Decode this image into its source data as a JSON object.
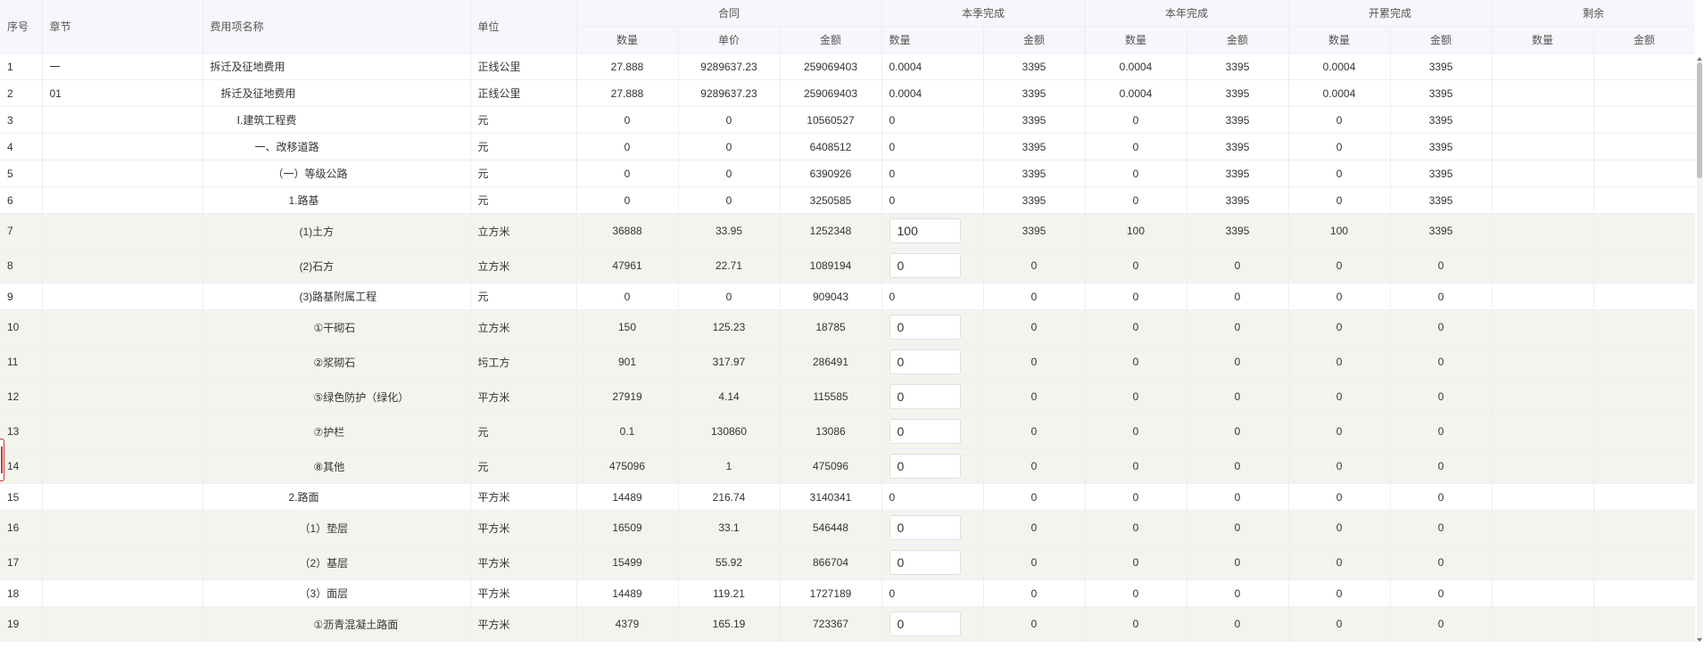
{
  "headers": {
    "seq": "序号",
    "chapter": "章节",
    "name": "费用项名称",
    "unit": "单位",
    "groups": [
      "合同",
      "本季完成",
      "本年完成",
      "开累完成",
      "剩余"
    ],
    "contract_sub": [
      "数量",
      "单价",
      "金额"
    ],
    "pair_sub": [
      "数量",
      "金额"
    ]
  },
  "rows": [
    {
      "seq": "1",
      "chapter": "一",
      "name": "拆迁及征地费用",
      "indent": 0,
      "unit": "正线公里",
      "c_qty": "27.888",
      "c_price": "9289637.23",
      "c_amt": "259069403",
      "q_qty": "0.0004",
      "q_amt": "3395",
      "y_qty": "0.0004",
      "y_amt": "3395",
      "t_qty": "0.0004",
      "t_amt": "3395",
      "r_qty": "",
      "r_amt": "",
      "editable": false
    },
    {
      "seq": "2",
      "chapter": "01",
      "name": "拆迁及征地费用",
      "indent": 1,
      "unit": "正线公里",
      "c_qty": "27.888",
      "c_price": "9289637.23",
      "c_amt": "259069403",
      "q_qty": "0.0004",
      "q_amt": "3395",
      "y_qty": "0.0004",
      "y_amt": "3395",
      "t_qty": "0.0004",
      "t_amt": "3395",
      "r_qty": "",
      "r_amt": "",
      "editable": false
    },
    {
      "seq": "3",
      "chapter": "",
      "name": "Ⅰ.建筑工程费",
      "indent": 2,
      "unit": "元",
      "c_qty": "0",
      "c_price": "0",
      "c_amt": "10560527",
      "q_qty": "0",
      "q_amt": "3395",
      "y_qty": "0",
      "y_amt": "3395",
      "t_qty": "0",
      "t_amt": "3395",
      "r_qty": "",
      "r_amt": "",
      "editable": false
    },
    {
      "seq": "4",
      "chapter": "",
      "name": "一、改移道路",
      "indent": 3,
      "unit": "元",
      "c_qty": "0",
      "c_price": "0",
      "c_amt": "6408512",
      "q_qty": "0",
      "q_amt": "3395",
      "y_qty": "0",
      "y_amt": "3395",
      "t_qty": "0",
      "t_amt": "3395",
      "r_qty": "",
      "r_amt": "",
      "editable": false
    },
    {
      "seq": "5",
      "chapter": "",
      "name": "（一）等级公路",
      "indent": 4,
      "unit": "元",
      "c_qty": "0",
      "c_price": "0",
      "c_amt": "6390926",
      "q_qty": "0",
      "q_amt": "3395",
      "y_qty": "0",
      "y_amt": "3395",
      "t_qty": "0",
      "t_amt": "3395",
      "r_qty": "",
      "r_amt": "",
      "editable": false
    },
    {
      "seq": "6",
      "chapter": "",
      "name": "1.路基",
      "indent": 5,
      "unit": "元",
      "c_qty": "0",
      "c_price": "0",
      "c_amt": "3250585",
      "q_qty": "0",
      "q_amt": "3395",
      "y_qty": "0",
      "y_amt": "3395",
      "t_qty": "0",
      "t_amt": "3395",
      "r_qty": "",
      "r_amt": "",
      "editable": false
    },
    {
      "seq": "7",
      "chapter": "",
      "name": "(1)土方",
      "indent": 6,
      "unit": "立方米",
      "c_qty": "36888",
      "c_price": "33.95",
      "c_amt": "1252348",
      "q_qty": "100",
      "q_amt": "3395",
      "y_qty": "100",
      "y_amt": "3395",
      "t_qty": "100",
      "t_amt": "3395",
      "r_qty": "",
      "r_amt": "",
      "editable": true
    },
    {
      "seq": "8",
      "chapter": "",
      "name": "(2)石方",
      "indent": 6,
      "unit": "立方米",
      "c_qty": "47961",
      "c_price": "22.71",
      "c_amt": "1089194",
      "q_qty": "0",
      "q_amt": "0",
      "y_qty": "0",
      "y_amt": "0",
      "t_qty": "0",
      "t_amt": "0",
      "r_qty": "",
      "r_amt": "",
      "editable": true
    },
    {
      "seq": "9",
      "chapter": "",
      "name": "(3)路基附属工程",
      "indent": 6,
      "unit": "元",
      "c_qty": "0",
      "c_price": "0",
      "c_amt": "909043",
      "q_qty": "0",
      "q_amt": "0",
      "y_qty": "0",
      "y_amt": "0",
      "t_qty": "0",
      "t_amt": "0",
      "r_qty": "",
      "r_amt": "",
      "editable": false
    },
    {
      "seq": "10",
      "chapter": "",
      "name": "①干砌石",
      "indent": 7,
      "unit": "立方米",
      "c_qty": "150",
      "c_price": "125.23",
      "c_amt": "18785",
      "q_qty": "0",
      "q_amt": "0",
      "y_qty": "0",
      "y_amt": "0",
      "t_qty": "0",
      "t_amt": "0",
      "r_qty": "",
      "r_amt": "",
      "editable": true
    },
    {
      "seq": "11",
      "chapter": "",
      "name": "②浆砌石",
      "indent": 7,
      "unit": "圬工方",
      "c_qty": "901",
      "c_price": "317.97",
      "c_amt": "286491",
      "q_qty": "0",
      "q_amt": "0",
      "y_qty": "0",
      "y_amt": "0",
      "t_qty": "0",
      "t_amt": "0",
      "r_qty": "",
      "r_amt": "",
      "editable": true
    },
    {
      "seq": "12",
      "chapter": "",
      "name": "⑤绿色防护（绿化）",
      "indent": 7,
      "unit": "平方米",
      "c_qty": "27919",
      "c_price": "4.14",
      "c_amt": "115585",
      "q_qty": "0",
      "q_amt": "0",
      "y_qty": "0",
      "y_amt": "0",
      "t_qty": "0",
      "t_amt": "0",
      "r_qty": "",
      "r_amt": "",
      "editable": true
    },
    {
      "seq": "13",
      "chapter": "",
      "name": "⑦护栏",
      "indent": 7,
      "unit": "元",
      "c_qty": "0.1",
      "c_price": "130860",
      "c_amt": "13086",
      "q_qty": "0",
      "q_amt": "0",
      "y_qty": "0",
      "y_amt": "0",
      "t_qty": "0",
      "t_amt": "0",
      "r_qty": "",
      "r_amt": "",
      "editable": true
    },
    {
      "seq": "14",
      "chapter": "",
      "name": "⑧其他",
      "indent": 7,
      "unit": "元",
      "c_qty": "475096",
      "c_price": "1",
      "c_amt": "475096",
      "q_qty": "0",
      "q_amt": "0",
      "y_qty": "0",
      "y_amt": "0",
      "t_qty": "0",
      "t_amt": "0",
      "r_qty": "",
      "r_amt": "",
      "editable": true
    },
    {
      "seq": "15",
      "chapter": "",
      "name": "2.路面",
      "indent": 5,
      "unit": "平方米",
      "c_qty": "14489",
      "c_price": "216.74",
      "c_amt": "3140341",
      "q_qty": "0",
      "q_amt": "0",
      "y_qty": "0",
      "y_amt": "0",
      "t_qty": "0",
      "t_amt": "0",
      "r_qty": "",
      "r_amt": "",
      "editable": false
    },
    {
      "seq": "16",
      "chapter": "",
      "name": "（1）垫层",
      "indent": 6,
      "unit": "平方米",
      "c_qty": "16509",
      "c_price": "33.1",
      "c_amt": "546448",
      "q_qty": "0",
      "q_amt": "0",
      "y_qty": "0",
      "y_amt": "0",
      "t_qty": "0",
      "t_amt": "0",
      "r_qty": "",
      "r_amt": "",
      "editable": true
    },
    {
      "seq": "17",
      "chapter": "",
      "name": "（2）基层",
      "indent": 6,
      "unit": "平方米",
      "c_qty": "15499",
      "c_price": "55.92",
      "c_amt": "866704",
      "q_qty": "0",
      "q_amt": "0",
      "y_qty": "0",
      "y_amt": "0",
      "t_qty": "0",
      "t_amt": "0",
      "r_qty": "",
      "r_amt": "",
      "editable": true
    },
    {
      "seq": "18",
      "chapter": "",
      "name": "（3）面层",
      "indent": 6,
      "unit": "平方米",
      "c_qty": "14489",
      "c_price": "119.21",
      "c_amt": "1727189",
      "q_qty": "0",
      "q_amt": "0",
      "y_qty": "0",
      "y_amt": "0",
      "t_qty": "0",
      "t_amt": "0",
      "r_qty": "",
      "r_amt": "",
      "editable": false
    },
    {
      "seq": "19",
      "chapter": "",
      "name": "①沥青混凝土路面",
      "indent": 7,
      "unit": "平方米",
      "c_qty": "4379",
      "c_price": "165.19",
      "c_amt": "723367",
      "q_qty": "0",
      "q_amt": "0",
      "y_qty": "0",
      "y_amt": "0",
      "t_qty": "0",
      "t_amt": "0",
      "r_qty": "",
      "r_amt": "",
      "editable": true
    }
  ]
}
